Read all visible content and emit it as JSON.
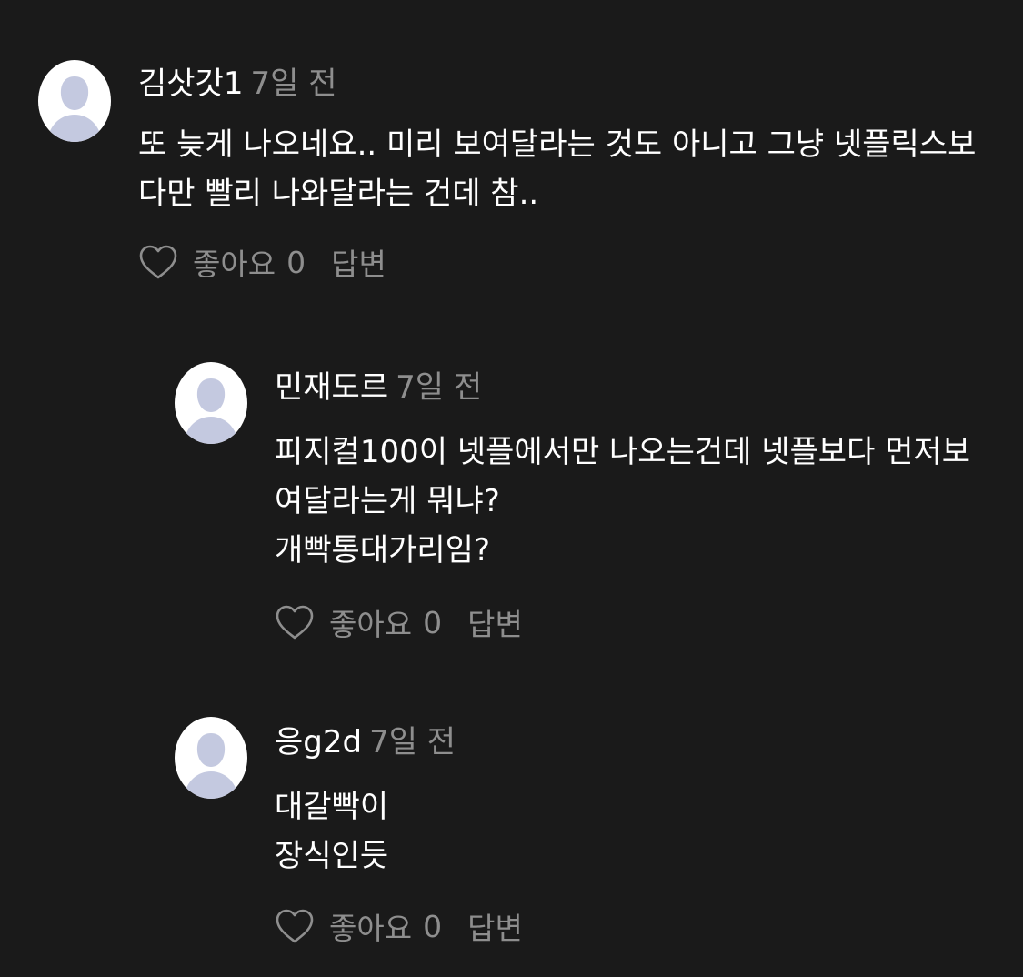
{
  "comments": [
    {
      "author": "김삿갓1",
      "time": "7일 전",
      "text": "또 늦게 나오네요.. 미리 보여달라는 것도 아니고 그냥 넷플릭스보다만 빨리 나와달라는 건데 참..",
      "like_label": "좋아요",
      "like_count": "0",
      "reply_label": "답변"
    },
    {
      "author": "민재도르",
      "time": "7일 전",
      "text": "피지컬100이 넷플에서만 나오는건데 넷플보다 먼저보여달라는게 뭐냐?\n개빡통대가리임?",
      "like_label": "좋아요",
      "like_count": "0",
      "reply_label": "답변"
    },
    {
      "author": "응g2d",
      "time": "7일 전",
      "text": "대갈빡이\n장식인듯",
      "like_label": "좋아요",
      "like_count": "0",
      "reply_label": "답변"
    }
  ],
  "icons": {
    "avatar": "default-user-avatar-icon",
    "like": "heart-outline-icon"
  },
  "colors": {
    "background": "#1a1a1a",
    "text": "#ffffff",
    "muted": "#8e8e8e",
    "avatar_bg": "#ffffff",
    "avatar_silhouette": "#c4c9e0"
  }
}
